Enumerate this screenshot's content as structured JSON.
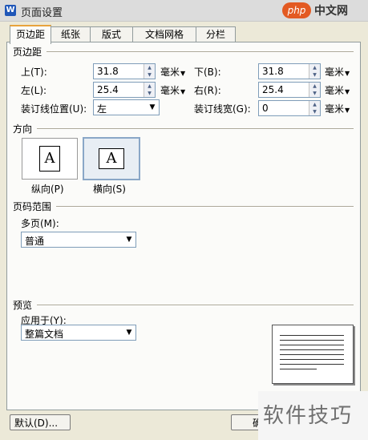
{
  "window": {
    "title": "页面设置"
  },
  "watermark": {
    "logo": "php",
    "site": "中文网",
    "bottom_text": "软件技巧"
  },
  "tabs": [
    {
      "label": "页边距",
      "active": true
    },
    {
      "label": "纸张",
      "active": false
    },
    {
      "label": "版式",
      "active": false
    },
    {
      "label": "文档网格",
      "active": false
    },
    {
      "label": "分栏",
      "active": false
    }
  ],
  "margins": {
    "section": "页边距",
    "top": {
      "label": "上(T):",
      "value": "31.8",
      "unit": "毫米"
    },
    "bottom": {
      "label": "下(B):",
      "value": "31.8",
      "unit": "毫米"
    },
    "left": {
      "label": "左(L):",
      "value": "25.4",
      "unit": "毫米"
    },
    "right": {
      "label": "右(R):",
      "value": "25.4",
      "unit": "毫米"
    },
    "gutter_pos": {
      "label": "装订线位置(U):",
      "value": "左"
    },
    "gutter_width": {
      "label": "装订线宽(G):",
      "value": "0",
      "unit": "毫米"
    }
  },
  "orientation": {
    "section": "方向",
    "portrait": {
      "label": "纵向(P)",
      "glyph": "A"
    },
    "landscape": {
      "label": "横向(S)",
      "glyph": "A",
      "selected": true
    }
  },
  "pages": {
    "section": "页码范围",
    "multi_label": "多页(M):",
    "multi_value": "普通"
  },
  "preview": {
    "section": "预览",
    "apply_label": "应用于(Y):",
    "apply_value": "整篇文档"
  },
  "buttons": {
    "default": "默认(D)...",
    "ok_partial": "确"
  }
}
